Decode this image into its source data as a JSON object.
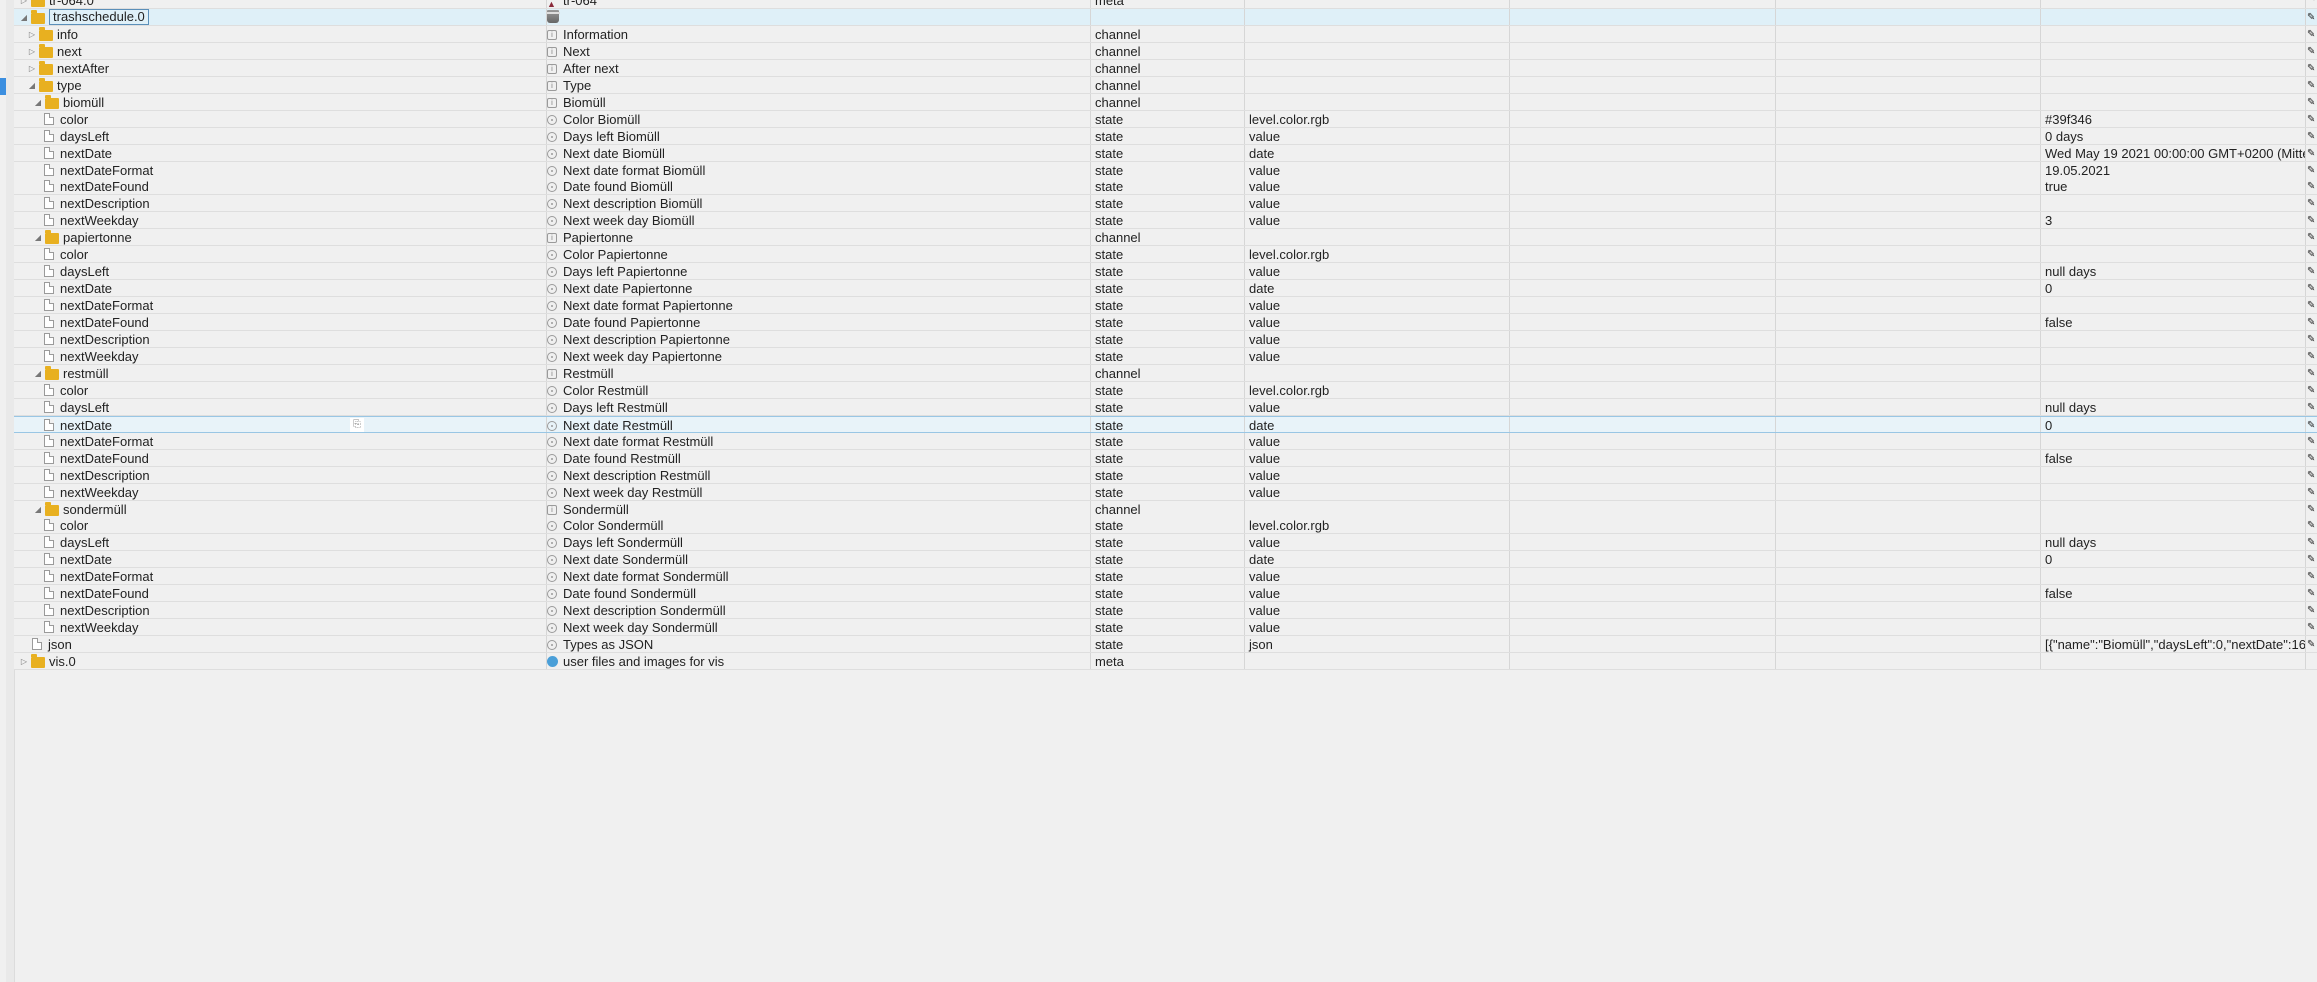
{
  "rows": [
    {
      "id": "tr-064.0",
      "name": "tr-064",
      "type": "meta",
      "role": "",
      "value": ""
    },
    {
      "id": "trashschedule.0",
      "name": "",
      "type": "",
      "role": "",
      "value": ""
    },
    {
      "id": "info",
      "name": "Information",
      "type": "channel",
      "role": "",
      "value": ""
    },
    {
      "id": "next",
      "name": "Next",
      "type": "channel",
      "role": "",
      "value": ""
    },
    {
      "id": "nextAfter",
      "name": "After next",
      "type": "channel",
      "role": "",
      "value": ""
    },
    {
      "id": "type",
      "name": "Type",
      "type": "channel",
      "role": "",
      "value": ""
    },
    {
      "id": "biomüll",
      "name": "Biomüll",
      "type": "channel",
      "role": "",
      "value": ""
    },
    {
      "id": "color",
      "name": "Color Biomüll",
      "type": "state",
      "role": "level.color.rgb",
      "value": "#39f346"
    },
    {
      "id": "daysLeft",
      "name": "Days left Biomüll",
      "type": "state",
      "role": "value",
      "value": "0 days"
    },
    {
      "id": "nextDate",
      "name": "Next date Biomüll",
      "type": "state",
      "role": "date",
      "value": "Wed May 19 2021 00:00:00 GMT+0200 (Mitte"
    },
    {
      "id": "nextDateFormat",
      "name": "Next date format Biomüll",
      "type": "state",
      "role": "value",
      "value": "19.05.2021"
    },
    {
      "id": "nextDateFound",
      "name": "Date found Biomüll",
      "type": "state",
      "role": "value",
      "value": "true"
    },
    {
      "id": "nextDescription",
      "name": "Next description Biomüll",
      "type": "state",
      "role": "value",
      "value": ""
    },
    {
      "id": "nextWeekday",
      "name": "Next week day Biomüll",
      "type": "state",
      "role": "value",
      "value": "3"
    },
    {
      "id": "papiertonne",
      "name": "Papiertonne",
      "type": "channel",
      "role": "",
      "value": ""
    },
    {
      "id": "color",
      "name": "Color Papiertonne",
      "type": "state",
      "role": "level.color.rgb",
      "value": ""
    },
    {
      "id": "daysLeft",
      "name": "Days left Papiertonne",
      "type": "state",
      "role": "value",
      "value": "null days"
    },
    {
      "id": "nextDate",
      "name": "Next date Papiertonne",
      "type": "state",
      "role": "date",
      "value": "0"
    },
    {
      "id": "nextDateFormat",
      "name": "Next date format Papiertonne",
      "type": "state",
      "role": "value",
      "value": ""
    },
    {
      "id": "nextDateFound",
      "name": "Date found Papiertonne",
      "type": "state",
      "role": "value",
      "value": "false"
    },
    {
      "id": "nextDescription",
      "name": "Next description Papiertonne",
      "type": "state",
      "role": "value",
      "value": ""
    },
    {
      "id": "nextWeekday",
      "name": "Next week day Papiertonne",
      "type": "state",
      "role": "value",
      "value": ""
    },
    {
      "id": "restmüll",
      "name": "Restmüll",
      "type": "channel",
      "role": "",
      "value": ""
    },
    {
      "id": "color",
      "name": "Color Restmüll",
      "type": "state",
      "role": "level.color.rgb",
      "value": ""
    },
    {
      "id": "daysLeft",
      "name": "Days left Restmüll",
      "type": "state",
      "role": "value",
      "value": "null days"
    },
    {
      "id": "nextDate",
      "name": "Next date Restmüll",
      "type": "state",
      "role": "date",
      "value": "0"
    },
    {
      "id": "nextDateFormat",
      "name": "Next date format Restmüll",
      "type": "state",
      "role": "value",
      "value": ""
    },
    {
      "id": "nextDateFound",
      "name": "Date found Restmüll",
      "type": "state",
      "role": "value",
      "value": "false"
    },
    {
      "id": "nextDescription",
      "name": "Next description Restmüll",
      "type": "state",
      "role": "value",
      "value": ""
    },
    {
      "id": "nextWeekday",
      "name": "Next week day Restmüll",
      "type": "state",
      "role": "value",
      "value": ""
    },
    {
      "id": "sondermüll",
      "name": "Sondermüll",
      "type": "channel",
      "role": "",
      "value": ""
    },
    {
      "id": "color",
      "name": "Color Sondermüll",
      "type": "state",
      "role": "level.color.rgb",
      "value": ""
    },
    {
      "id": "daysLeft",
      "name": "Days left Sondermüll",
      "type": "state",
      "role": "value",
      "value": "null days"
    },
    {
      "id": "nextDate",
      "name": "Next date Sondermüll",
      "type": "state",
      "role": "date",
      "value": "0"
    },
    {
      "id": "nextDateFormat",
      "name": "Next date format Sondermüll",
      "type": "state",
      "role": "value",
      "value": ""
    },
    {
      "id": "nextDateFound",
      "name": "Date found Sondermüll",
      "type": "state",
      "role": "value",
      "value": "false"
    },
    {
      "id": "nextDescription",
      "name": "Next description Sondermüll",
      "type": "state",
      "role": "value",
      "value": ""
    },
    {
      "id": "nextWeekday",
      "name": "Next week day Sondermüll",
      "type": "state",
      "role": "value",
      "value": ""
    },
    {
      "id": "json",
      "name": "Types as JSON",
      "type": "state",
      "role": "json",
      "value": "[{\"name\":\"Biomüll\",\"daysLeft\":0,\"nextDate\":16"
    },
    {
      "id": "vis.0",
      "name": "user files and images for vis",
      "type": "meta",
      "role": "",
      "value": ""
    }
  ],
  "colors": {
    "folder": "#e8b020",
    "selected_row": "#dff0f8",
    "hovered_row": "#e8f3f9",
    "accent": "#3c8fe0"
  },
  "icons": {
    "edit": "pencil-icon",
    "copy": "copy-icon",
    "folder": "folder-icon",
    "state": "file-icon"
  }
}
